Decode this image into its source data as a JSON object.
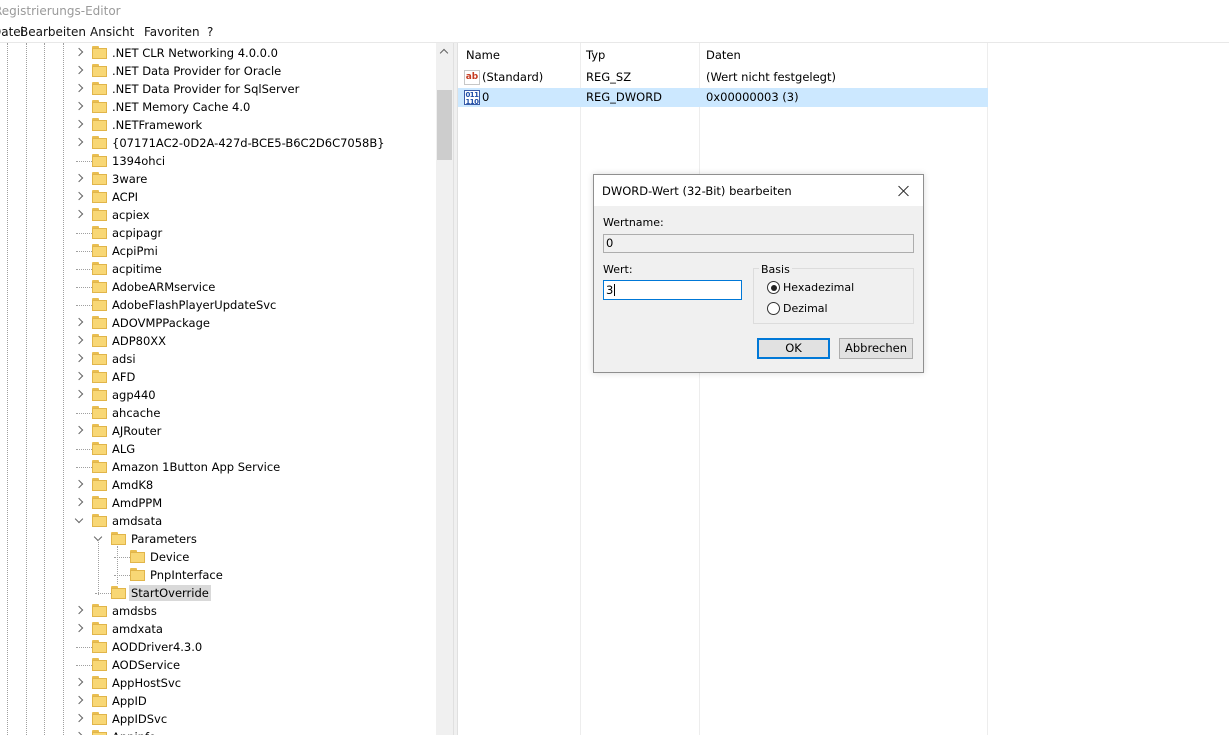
{
  "window": {
    "title": "Registrierungs-Editor"
  },
  "menu": {
    "items": [
      "Datei",
      "Bearbeiten",
      "Ansicht",
      "Favoriten",
      "?"
    ]
  },
  "tree": {
    "rows": [
      {
        "label": ".NET CLR Networking 4.0.0.0",
        "expander": "right"
      },
      {
        "label": ".NET Data Provider for Oracle",
        "expander": "right"
      },
      {
        "label": ".NET Data Provider for SqlServer",
        "expander": "right"
      },
      {
        "label": ".NET Memory Cache 4.0",
        "expander": "right"
      },
      {
        "label": ".NETFramework",
        "expander": "right"
      },
      {
        "label": "{07171AC2-0D2A-427d-BCE5-B6C2D6C7058B}",
        "expander": "right"
      },
      {
        "label": "1394ohci",
        "expander": "none"
      },
      {
        "label": "3ware",
        "expander": "right"
      },
      {
        "label": "ACPI",
        "expander": "right"
      },
      {
        "label": "acpiex",
        "expander": "right"
      },
      {
        "label": "acpipagr",
        "expander": "none"
      },
      {
        "label": "AcpiPmi",
        "expander": "none"
      },
      {
        "label": "acpitime",
        "expander": "none"
      },
      {
        "label": "AdobeARMservice",
        "expander": "none"
      },
      {
        "label": "AdobeFlashPlayerUpdateSvc",
        "expander": "none"
      },
      {
        "label": "ADOVMPPackage",
        "expander": "right"
      },
      {
        "label": "ADP80XX",
        "expander": "right"
      },
      {
        "label": "adsi",
        "expander": "right"
      },
      {
        "label": "AFD",
        "expander": "right"
      },
      {
        "label": "agp440",
        "expander": "right"
      },
      {
        "label": "ahcache",
        "expander": "none"
      },
      {
        "label": "AJRouter",
        "expander": "right"
      },
      {
        "label": "ALG",
        "expander": "none"
      },
      {
        "label": "Amazon 1Button App Service",
        "expander": "none"
      },
      {
        "label": "AmdK8",
        "expander": "right"
      },
      {
        "label": "AmdPPM",
        "expander": "right"
      },
      {
        "label": "amdsata",
        "expander": "down"
      },
      {
        "label": "Parameters",
        "expander": "down"
      },
      {
        "label": "Device",
        "expander": "none"
      },
      {
        "label": "PnpInterface",
        "expander": "none"
      },
      {
        "label": "StartOverride",
        "expander": "none",
        "selected": true
      },
      {
        "label": "amdsbs",
        "expander": "right"
      },
      {
        "label": "amdxata",
        "expander": "right"
      },
      {
        "label": "AODDriver4.3.0",
        "expander": "none"
      },
      {
        "label": "AODService",
        "expander": "none"
      },
      {
        "label": "AppHostSvc",
        "expander": "right"
      },
      {
        "label": "AppID",
        "expander": "right"
      },
      {
        "label": "AppIDSvc",
        "expander": "right"
      },
      {
        "label": "Appinfo",
        "expander": "right"
      }
    ]
  },
  "list": {
    "columns": [
      "Name",
      "Typ",
      "Daten"
    ],
    "rows": [
      {
        "icon": "string-value-icon",
        "icon_text": "ab",
        "name": "(Standard)",
        "type": "REG_SZ",
        "data": "(Wert nicht festgelegt)",
        "selected": false
      },
      {
        "icon": "binary-value-icon",
        "icon_text": "011 110",
        "name": "0",
        "type": "REG_DWORD",
        "data": "0x00000003 (3)",
        "selected": true
      }
    ]
  },
  "dialog": {
    "title": "DWORD-Wert (32-Bit) bearbeiten",
    "valuename_label": "Wertname:",
    "valuename": "0",
    "value_label": "Wert:",
    "value": "3",
    "base_label": "Basis",
    "base_options": [
      "Hexadezimal",
      "Dezimal"
    ],
    "base_selected": "Hexadezimal",
    "ok_label": "OK",
    "cancel_label": "Abbrechen"
  },
  "colors": {
    "selection": "#cce8ff",
    "tree_selection": "#d9d9d9",
    "folder": "#f8d775",
    "dialog_bg": "#f0f0f0",
    "accent": "#0078d7"
  }
}
